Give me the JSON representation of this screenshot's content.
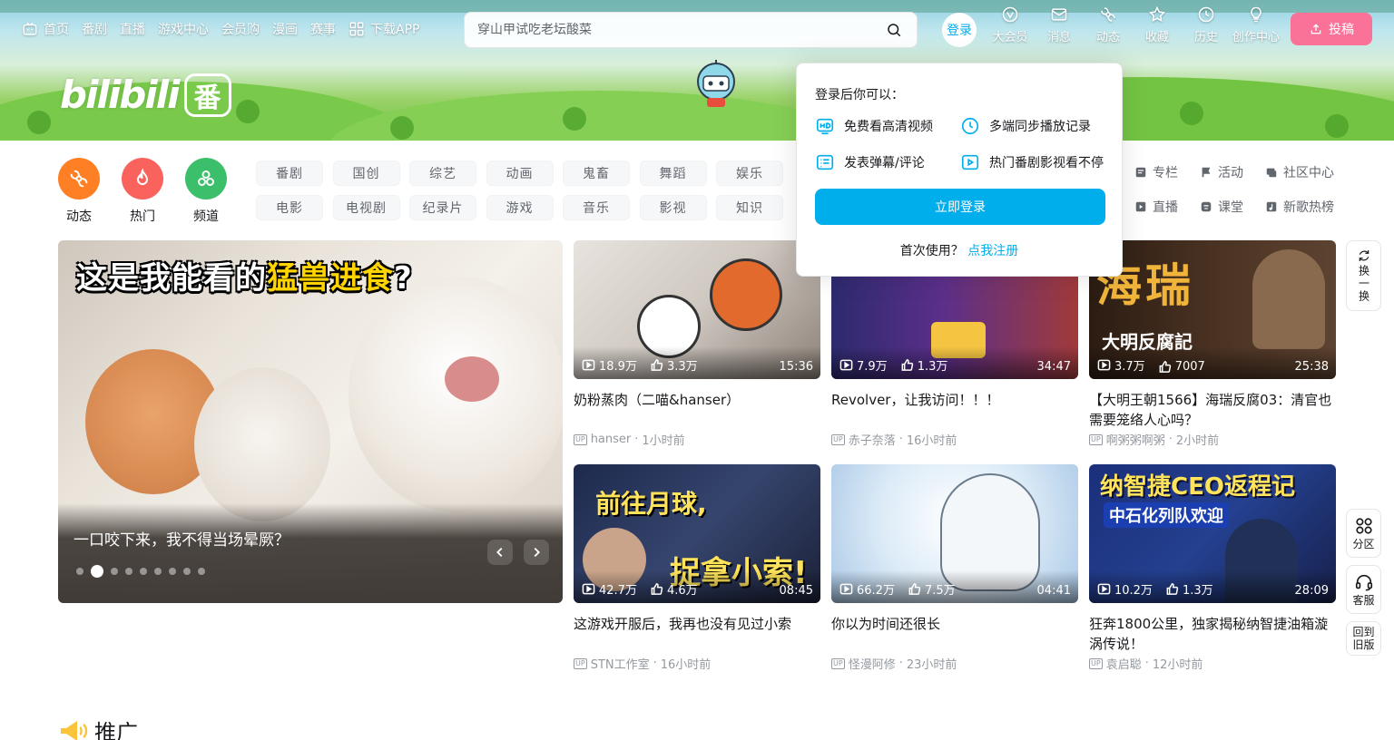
{
  "colors": {
    "accent": "#00aeec",
    "pink": "#fb7299",
    "text": "#18191c",
    "muted": "#9499a0"
  },
  "topnav": [
    {
      "label": "首页",
      "icon": "tv-icon"
    },
    {
      "label": "番剧"
    },
    {
      "label": "直播"
    },
    {
      "label": "游戏中心"
    },
    {
      "label": "会员购"
    },
    {
      "label": "漫画"
    },
    {
      "label": "赛事"
    },
    {
      "label": "下载APP",
      "icon": "grid-icon"
    }
  ],
  "search": {
    "placeholder": "穿山甲试吃老坛酸菜"
  },
  "login_avatar": "登录",
  "user_icons": [
    {
      "label": "大会员",
      "icon": "vip-icon"
    },
    {
      "label": "消息",
      "icon": "mail-icon"
    },
    {
      "label": "动态",
      "icon": "dynamic-icon"
    },
    {
      "label": "收藏",
      "icon": "star-icon"
    },
    {
      "label": "历史",
      "icon": "clock-icon"
    },
    {
      "label": "创作中心",
      "icon": "bulb-icon"
    }
  ],
  "upload_label": "投稿",
  "logo": {
    "text": "bilibili",
    "badge": "番"
  },
  "quick": [
    {
      "label": "动态",
      "color": "#ff7f24"
    },
    {
      "label": "热门",
      "color": "#f9625d"
    },
    {
      "label": "频道",
      "color": "#3bbf6a"
    }
  ],
  "channels": {
    "row1": [
      "番剧",
      "国创",
      "综艺",
      "动画",
      "鬼畜",
      "舞蹈",
      "娱乐"
    ],
    "row2": [
      "电影",
      "电视剧",
      "纪录片",
      "游戏",
      "音乐",
      "影视",
      "知识"
    ]
  },
  "side_links": [
    {
      "label": "专栏",
      "icon": "article-icon"
    },
    {
      "label": "活动",
      "icon": "flag-icon"
    },
    {
      "label": "社区中心",
      "icon": "community-icon"
    },
    {
      "label": "直播",
      "icon": "live-icon"
    },
    {
      "label": "课堂",
      "icon": "class-icon"
    },
    {
      "label": "新歌热榜",
      "icon": "music-icon"
    }
  ],
  "carousel": {
    "headline_pre": "这是我能看的",
    "headline_hl": "猛兽",
    "headline_mid": "进食",
    "headline_post": "?",
    "caption": "一口咬下来，我不得当场晕厥？",
    "dots": 9,
    "active_dot": 1
  },
  "videos": [
    {
      "title": "奶粉蒸肉（二喵&hanser）",
      "views": "18.9万",
      "likes": "3.3万",
      "duration": "15:36",
      "author": "hanser",
      "time": "1小时前",
      "color": "#d9d3cf"
    },
    {
      "title": "Revolver，让我访问！！！",
      "views": "7.9万",
      "likes": "1.3万",
      "duration": "34:47",
      "author": "赤子奈落",
      "time": "16小时前",
      "color": "#3c2f6e"
    },
    {
      "title": "【大明王朝1566】海瑞反腐03：清官也需要笼络人心吗？",
      "views": "3.7万",
      "likes": "7007",
      "duration": "25:38",
      "author": "啊粥粥啊粥",
      "time": "2小时前",
      "color": "#3a2a20"
    },
    {
      "title": "这游戏开服后，我再也没有见过小索",
      "views": "42.7万",
      "likes": "4.6万",
      "duration": "08:45",
      "author": "STN工作室",
      "time": "16小时前",
      "color": "#2a3454"
    },
    {
      "title": "你以为时间还很长",
      "views": "66.2万",
      "likes": "7.5万",
      "duration": "04:41",
      "author": "怪漫阿修",
      "time": "23小时前",
      "color": "#bcd7ee"
    },
    {
      "title": "狂奔1800公里，独家揭秘纳智捷油箱漩涡传说！",
      "views": "10.2万",
      "likes": "1.3万",
      "duration": "28:09",
      "author": "袁启聪",
      "time": "12小时前",
      "color": "#1f3b8a"
    }
  ],
  "thumb_text": {
    "v3_main": "海瑞",
    "v3_sub": "大明反腐記",
    "v4_main": "前往月球,",
    "v4_sub": "捉拿小索!",
    "v6_main": "纳智捷CEO返程记",
    "v6_sub": "中石化列队欢迎"
  },
  "float": {
    "refresh": "换一换",
    "category": "分区",
    "service": "客服",
    "old_version": "回到旧版"
  },
  "section_title": "推广",
  "popover": {
    "title": "登录后你可以：",
    "benefits": [
      {
        "label": "免费看高清视频",
        "icon": "hd-icon"
      },
      {
        "label": "多端同步播放记录",
        "icon": "sync-clock-icon"
      },
      {
        "label": "发表弹幕/评论",
        "icon": "danmaku-icon"
      },
      {
        "label": "热门番剧影视看不停",
        "icon": "play-icon"
      }
    ],
    "login_button": "立即登录",
    "register_prompt": "首次使用？",
    "register_link": "点我注册"
  }
}
